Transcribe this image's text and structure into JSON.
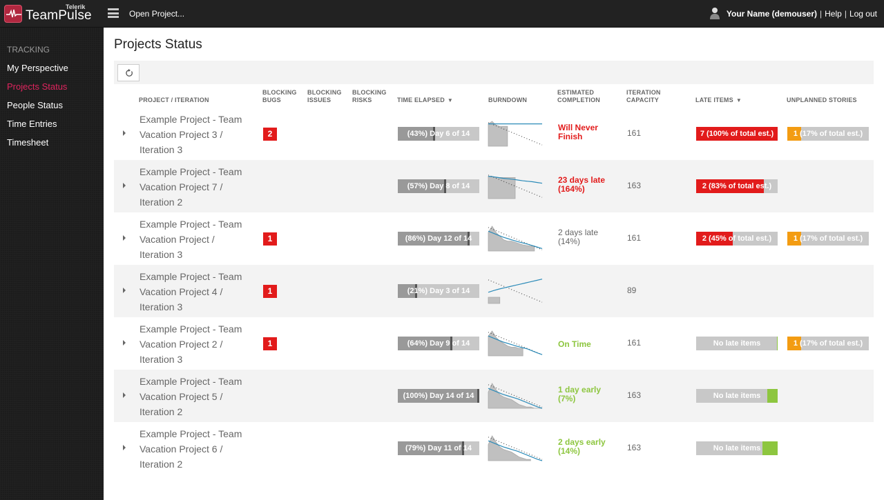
{
  "header": {
    "brand": "TeamPulse",
    "brand_sub": "Telerik",
    "open_project": "Open Project...",
    "user_name": "Your Name (demouser)",
    "help": "Help",
    "logout": "Log out",
    "separator": "|"
  },
  "sidebar": {
    "section": "TRACKING",
    "items": [
      {
        "label": "My Perspective",
        "active": false
      },
      {
        "label": "Projects Status",
        "active": true
      },
      {
        "label": "People Status",
        "active": false
      },
      {
        "label": "Time Entries",
        "active": false
      },
      {
        "label": "Timesheet",
        "active": false
      }
    ]
  },
  "page": {
    "title": "Projects Status"
  },
  "columns": {
    "project": "PROJECT / ITERATION",
    "bugs_1": "BLOCKING",
    "bugs_2": "BUGS",
    "issues_1": "BLOCKING",
    "issues_2": "ISSUES",
    "risks_1": "BLOCKING",
    "risks_2": "RISKS",
    "time": "TIME ELAPSED",
    "burndown": "BURNDOWN",
    "est_1": "ESTIMATED",
    "est_2": "COMPLETION",
    "cap_1": "ITERATION",
    "cap_2": "CAPACITY",
    "late": "LATE ITEMS",
    "unplanned": "UNPLANNED STORIES",
    "sort_glyph": "▼"
  },
  "colors": {
    "accent": "#e0245e",
    "red": "#e21b1b",
    "green": "#8dc63f",
    "orange": "#f39c12",
    "bar_bg": "#c8c8c8",
    "bar_fill": "#999999"
  },
  "rows": [
    {
      "name_1": "Example Project - Team",
      "name_2": "Vacation Project 3 /",
      "name_3": "Iteration 3",
      "bugs": "2",
      "time_pct": 43,
      "time_label": "(43%) Day 6 of 14",
      "burndown": {
        "ideal_start": 0.9,
        "actual": [
          0.9,
          0.9,
          0.9,
          0.9,
          0.9,
          0.9,
          0.9,
          0.9,
          0.9,
          0.9,
          0.9,
          0.9
        ],
        "remaining": [
          0.9,
          1.0,
          0.85,
          0.8,
          0.8,
          0.8
        ],
        "days": 14
      },
      "est": "Will Never Finish",
      "est_color": "red",
      "capacity": "161",
      "late": {
        "pct": 100,
        "label": "7 (100% of total est.)",
        "none": false
      },
      "unplanned": {
        "pct": 17,
        "label": "1 (17% of total est.)"
      }
    },
    {
      "name_1": "Example Project - Team",
      "name_2": "Vacation Project 7 /",
      "name_3": "Iteration 2",
      "bugs": "",
      "time_pct": 57,
      "time_label": "(57%) Day 8 of 14",
      "burndown": {
        "actual": [
          0.9,
          0.88,
          0.85,
          0.82,
          0.8,
          0.78,
          0.75,
          0.72,
          0.7,
          0.68,
          0.65,
          0.62
        ],
        "remaining": [
          0.9,
          0.9,
          0.85,
          0.85,
          0.85,
          0.85,
          0.85,
          0.85
        ],
        "days": 14
      },
      "est": "23 days late (164%)",
      "est_color": "red",
      "capacity": "163",
      "late": {
        "pct": 83,
        "label": "2 (83% of total est.)",
        "none": false
      },
      "unplanned": null
    },
    {
      "name_1": "Example Project - Team",
      "name_2": "Vacation Project /",
      "name_3": "Iteration 3",
      "bugs": "1",
      "time_pct": 86,
      "time_label": "(86%) Day 12 of 14",
      "burndown": {
        "actual": [
          0.8,
          0.72,
          0.64,
          0.56,
          0.5,
          0.44,
          0.38,
          0.33,
          0.28,
          0.22,
          0.16,
          0.1
        ],
        "remaining": [
          0.75,
          1.0,
          0.75,
          0.6,
          0.45,
          0.4,
          0.4,
          0.35,
          0.3,
          0.25,
          0.22,
          0.2,
          0.2
        ],
        "days": 14
      },
      "est": "2 days late (14%)",
      "est_color": "gray",
      "capacity": "161",
      "late": {
        "pct": 45,
        "label": "2 (45% of total est.)",
        "none": false
      },
      "unplanned": {
        "pct": 17,
        "label": "1 (17% of total est.)"
      }
    },
    {
      "name_1": "Example Project - Team",
      "name_2": "Vacation Project 4 /",
      "name_3": "Iteration 3",
      "bugs": "1",
      "time_pct": 21,
      "time_label": "(21%) Day 3 of 14",
      "burndown": {
        "actual": [
          0.45,
          0.52,
          0.58,
          0.63,
          0.68,
          0.73,
          0.78,
          0.83,
          0.88,
          0.93,
          0.98
        ],
        "remaining": [
          0.25,
          0.25,
          0.25,
          0.25
        ],
        "days": 14
      },
      "est": "",
      "est_color": "gray",
      "capacity": "89",
      "late": null,
      "unplanned": null
    },
    {
      "name_1": "Example Project - Team",
      "name_2": "Vacation Project 2 /",
      "name_3": "Iteration 3",
      "bugs": "1",
      "time_pct": 64,
      "time_label": "(64%) Day 9 of 14",
      "burndown": {
        "actual": [
          0.8,
          0.72,
          0.64,
          0.56,
          0.5,
          0.44,
          0.38,
          0.33,
          0.28,
          0.2,
          0.12,
          0.05
        ],
        "remaining": [
          0.8,
          1.0,
          0.75,
          0.6,
          0.5,
          0.4,
          0.35,
          0.35,
          0.3,
          0.3
        ],
        "days": 14
      },
      "est": "On Time",
      "est_color": "green",
      "capacity": "161",
      "late": {
        "pct": 0,
        "label": "No late items",
        "none": true,
        "green_pct": 1
      },
      "unplanned": {
        "pct": 17,
        "label": "1 (17% of total est.)"
      }
    },
    {
      "name_1": "Example Project - Team",
      "name_2": "Vacation Project 5 /",
      "name_3": "Iteration 2",
      "bugs": "",
      "time_pct": 100,
      "time_label": "(100%) Day 14 of 14",
      "burndown": {
        "actual": [
          0.8,
          0.72,
          0.64,
          0.56,
          0.5,
          0.44,
          0.38,
          0.3,
          0.22,
          0.14,
          0.06,
          0.0
        ],
        "remaining": [
          0.65,
          1.0,
          0.75,
          0.55,
          0.45,
          0.4,
          0.35,
          0.25,
          0.15,
          0.1,
          0.05,
          0.05,
          0.0,
          0.0,
          0.0
        ],
        "days": 14
      },
      "est": "1 day early (7%)",
      "est_color": "green",
      "capacity": "163",
      "late": {
        "pct": 0,
        "label": "No late items",
        "none": true,
        "green_pct": 13
      },
      "unplanned": null
    },
    {
      "name_1": "Example Project - Team",
      "name_2": "Vacation Project 6 /",
      "name_3": "Iteration 2",
      "bugs": "",
      "time_pct": 79,
      "time_label": "(79%) Day 11 of 14",
      "burndown": {
        "actual": [
          0.8,
          0.72,
          0.64,
          0.56,
          0.5,
          0.44,
          0.38,
          0.3,
          0.22,
          0.14,
          0.06,
          0.0
        ],
        "remaining": [
          0.65,
          1.0,
          0.75,
          0.55,
          0.45,
          0.4,
          0.35,
          0.25,
          0.15,
          0.1,
          0.05,
          0.05
        ],
        "days": 14
      },
      "est": "2 days early (14%)",
      "est_color": "green",
      "capacity": "163",
      "late": {
        "pct": 0,
        "label": "No late items",
        "none": true,
        "green_pct": 19
      },
      "unplanned": null
    }
  ]
}
